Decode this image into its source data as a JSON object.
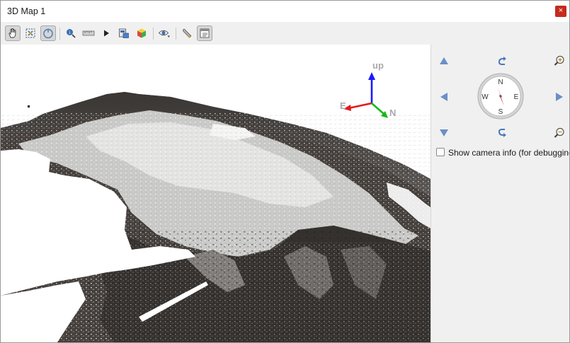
{
  "window": {
    "title": "3D Map 1",
    "close_glyph": "×"
  },
  "toolbar": {
    "buttons": [
      {
        "name": "pan-tool",
        "icon": "hand-icon",
        "active": true
      },
      {
        "name": "zoom-full",
        "icon": "zoom-full-icon",
        "active": false
      },
      {
        "name": "camera-control",
        "icon": "camera-control-icon",
        "active": true
      },
      {
        "name": "identify-tool",
        "icon": "identify-icon",
        "active": false
      },
      {
        "name": "measure-tool",
        "icon": "measure-line-icon",
        "active": false
      },
      {
        "name": "animation",
        "icon": "play-icon",
        "active": false
      },
      {
        "name": "save-export",
        "icon": "export-icon",
        "active": false
      },
      {
        "name": "effects",
        "icon": "cube-icon",
        "active": false
      },
      {
        "name": "camera-view",
        "icon": "eye-icon",
        "active": false
      },
      {
        "name": "options",
        "icon": "wrench-icon",
        "active": false
      },
      {
        "name": "layout",
        "icon": "layout-icon",
        "active": false
      }
    ]
  },
  "axes": {
    "up": "up",
    "east": "E",
    "north": "N"
  },
  "navigation": {
    "compass": {
      "north": "N",
      "south": "S",
      "east": "E",
      "west": "W"
    },
    "show_camera_info_label": "Show camera info (for debugging)",
    "show_camera_info_checked": false
  },
  "colors": {
    "nav_arrow": "#6b8fc7",
    "axis_up": "#1a1aff",
    "axis_east": "#e21b1b",
    "axis_north": "#17b817",
    "compass_needle": "#e02020"
  }
}
